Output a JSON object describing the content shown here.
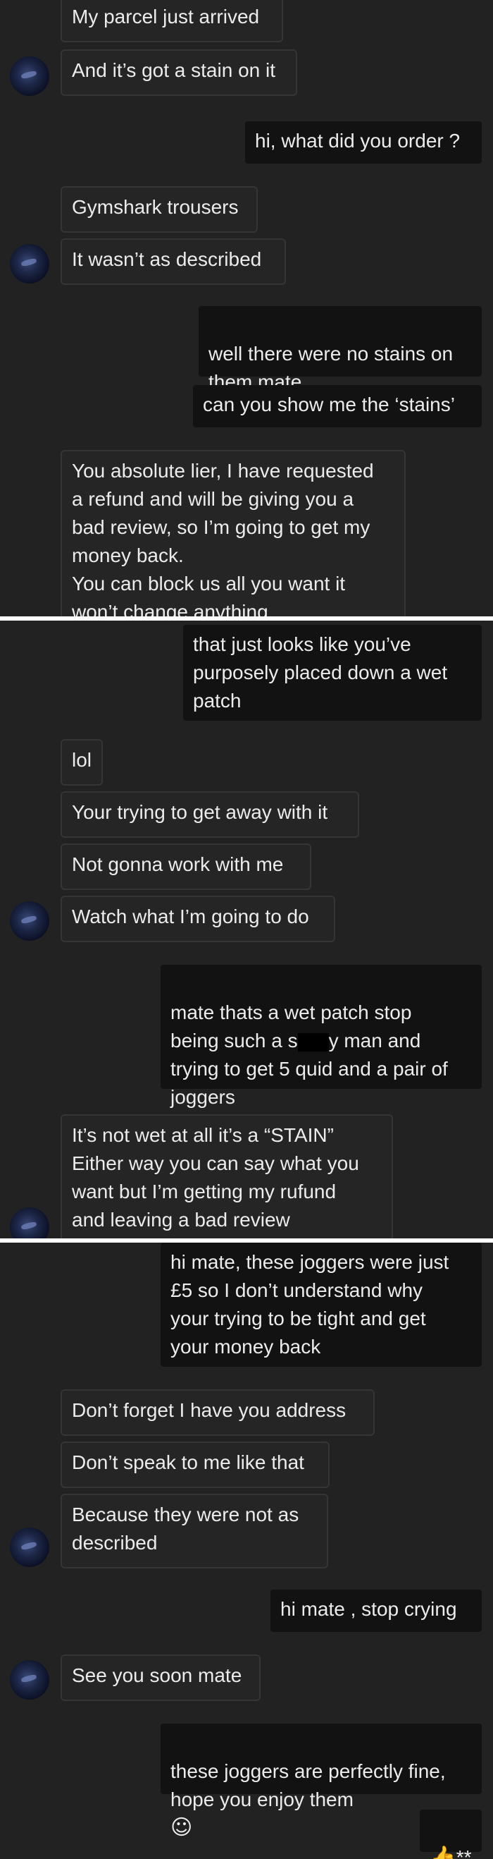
{
  "sections": [
    {
      "messages": [
        {
          "text": "My parcel just arrived"
        },
        {
          "text": "And it’s got a stain on it"
        },
        {
          "text": "hi, what did you order ?"
        },
        {
          "text": "Gymshark trousers"
        },
        {
          "text": "It wasn’t as described"
        },
        {
          "text": "well there were no stains on\nthem mate",
          "emoji": "👍"
        },
        {
          "text": "can you show me the ‘stains’"
        },
        {
          "text": "You absolute lier, I have requested\na refund and will be giving you a\nbad review, so I’m going to get my\nmoney back.\nYou can block us all you want it\nwon’t change anything"
        }
      ]
    },
    {
      "messages": [
        {
          "text": "that just looks like you’ve\npurposely placed down a wet\npatch"
        },
        {
          "text": "lol"
        },
        {
          "text": "Your trying to get away with it"
        },
        {
          "text": "Not gonna work with me"
        },
        {
          "text": "Watch what I’m going to do"
        },
        {
          "text_before": "mate thats a wet patch stop\nbeing such a s",
          "text_after": "y man and\ntrying to get 5 quid and a pair of\njoggers"
        },
        {
          "text": "It’s not wet at all it’s a “STAIN”\nEither way you can say what you\nwant but I’m getting my rufund\nand leaving a bad review"
        }
      ]
    },
    {
      "messages": [
        {
          "text": "hi mate, these joggers were just\n£5 so I don’t understand why\nyour trying to be tight and get\nyour money back"
        },
        {
          "text": "Don’t forget I have you address"
        },
        {
          "text": "Don’t speak to me like that"
        },
        {
          "text": "Because they were not as\ndescribed"
        },
        {
          "text": "hi mate , stop crying"
        },
        {
          "text": "See you soon mate"
        },
        {
          "text": "these joggers are perfectly fine,\nhope you enjoy them",
          "emoji": "☺"
        },
        {
          "emoji": "👍",
          "text": "**"
        }
      ]
    }
  ],
  "colors": {
    "background": "#222223",
    "incoming_bubble": "#252526",
    "outgoing_bubble": "#121212",
    "divider": "#ffffff"
  }
}
